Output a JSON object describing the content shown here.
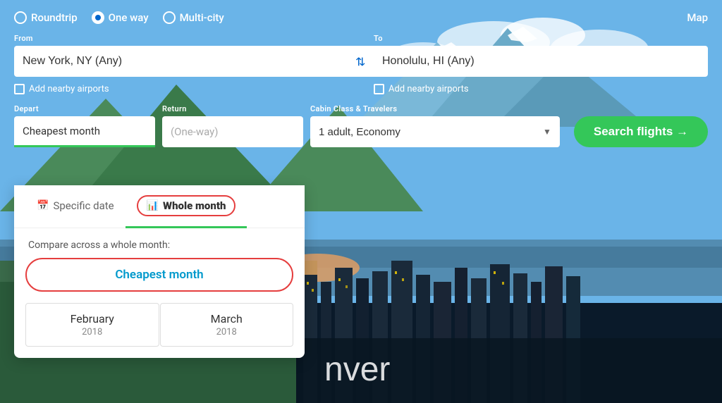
{
  "header": {
    "trip_types": [
      {
        "label": "Roundtrip",
        "value": "roundtrip",
        "selected": false
      },
      {
        "label": "One way",
        "value": "oneway",
        "selected": true
      },
      {
        "label": "Multi-city",
        "value": "multicity",
        "selected": false
      }
    ],
    "map_label": "Map"
  },
  "from_field": {
    "label": "From",
    "value": "New York, NY (Any)",
    "placeholder": "From"
  },
  "to_field": {
    "label": "To",
    "value": "Honolulu, HI (Any)",
    "placeholder": "To"
  },
  "nearby_from": {
    "label": "Add nearby airports"
  },
  "nearby_to": {
    "label": "Add nearby airports"
  },
  "depart_field": {
    "label": "Depart",
    "value": "Cheapest month"
  },
  "return_field": {
    "label": "Return",
    "value": "(One-way)"
  },
  "cabin_field": {
    "label": "Cabin Class & Travelers",
    "value": "1 adult, Economy"
  },
  "search_button": {
    "label": "Search flights →"
  },
  "dropdown": {
    "tab_specific": "Specific date",
    "tab_whole": "Whole month",
    "compare_text": "Compare across a whole month:",
    "cheapest_label": "Cheapest month",
    "months": [
      {
        "name": "February",
        "year": "2018"
      },
      {
        "name": "March",
        "year": "2018"
      }
    ]
  },
  "city_overlay": {
    "name": "nver"
  }
}
